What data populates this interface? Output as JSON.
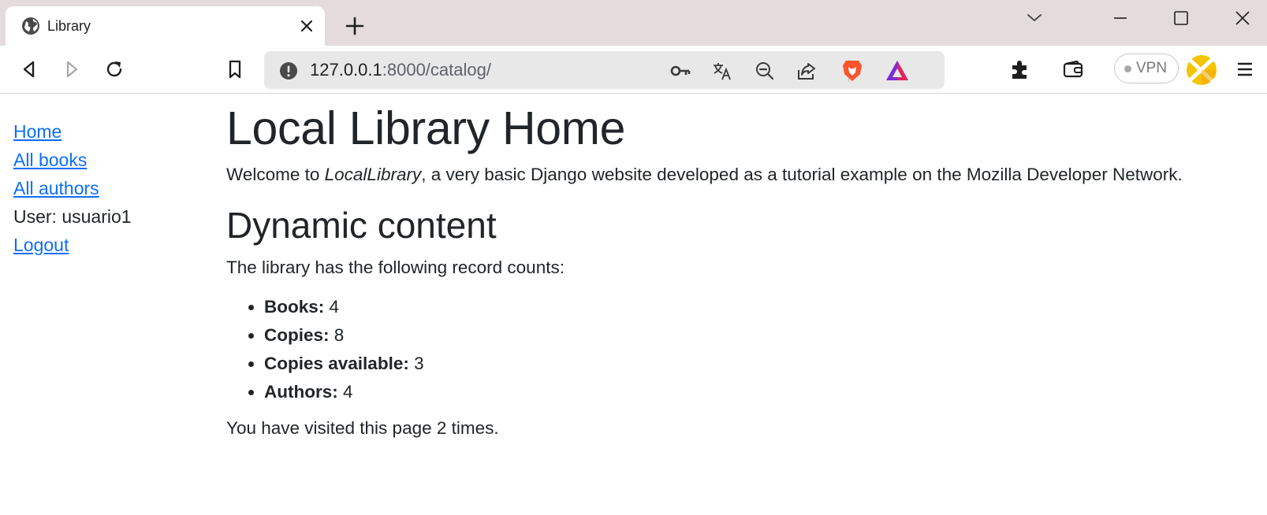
{
  "browser": {
    "tab": {
      "title": "Library"
    },
    "url": {
      "host": "127.0.0.1",
      "rest": ":8000/catalog/"
    },
    "vpn_label": "VPN",
    "icons": [
      "globe-icon",
      "close-icon",
      "plus-icon",
      "tab-search-icon",
      "minimize-icon",
      "maximize-icon",
      "window-close-icon",
      "back-icon",
      "forward-icon",
      "reload-icon",
      "bookmark-icon",
      "site-info-icon",
      "key-icon",
      "translate-icon",
      "zoom-out-icon",
      "share-icon",
      "brave-shields-icon",
      "brave-rewards-icon",
      "extensions-icon",
      "wallet-icon",
      "profile-icon",
      "menu-icon"
    ],
    "accent_colors": {
      "brave": "#fb542b",
      "rewards": "#7b2bd9",
      "link": "#0d6efd"
    }
  },
  "sidebar": {
    "home": "Home",
    "all_books": "All books",
    "all_authors": "All authors",
    "user": "User: usuario1",
    "logout": "Logout"
  },
  "main": {
    "title": "Local Library Home",
    "welcome": {
      "before": "Welcome to ",
      "em": "LocalLibrary",
      "after": ", a very basic Django website developed as a tutorial example on the Mozilla Developer Network."
    },
    "dynamic_heading": "Dynamic content",
    "counts_intro": "The library has the following record counts:",
    "counts": [
      {
        "label": "Books:",
        "value": "4"
      },
      {
        "label": "Copies:",
        "value": "8"
      },
      {
        "label": "Copies available:",
        "value": "3"
      },
      {
        "label": "Authors:",
        "value": "4"
      }
    ],
    "visits": "You have visited this page 2 times."
  }
}
